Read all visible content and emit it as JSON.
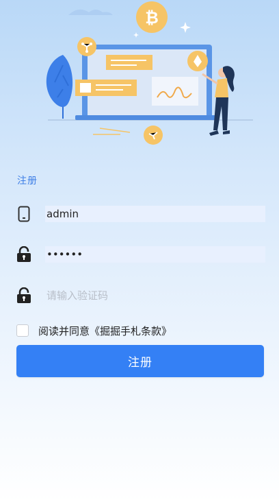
{
  "header": {
    "illustration": "crypto-laptop-illustration"
  },
  "form": {
    "title": "注册",
    "username": {
      "icon": "phone-icon",
      "value": "admin"
    },
    "password": {
      "icon": "lock-icon",
      "value": "••••••"
    },
    "verify_code": {
      "icon": "lock-icon",
      "placeholder": "请输入验证码",
      "value": ""
    },
    "agreement": {
      "checked": false,
      "label": "阅读并同意《掘掘手札条款》"
    },
    "submit_label": "注册"
  },
  "colors": {
    "accent": "#3480f5",
    "title_blue": "#3f7fe6",
    "field_fill": "#e8f0fe",
    "coin_gold": "#f6c466"
  }
}
